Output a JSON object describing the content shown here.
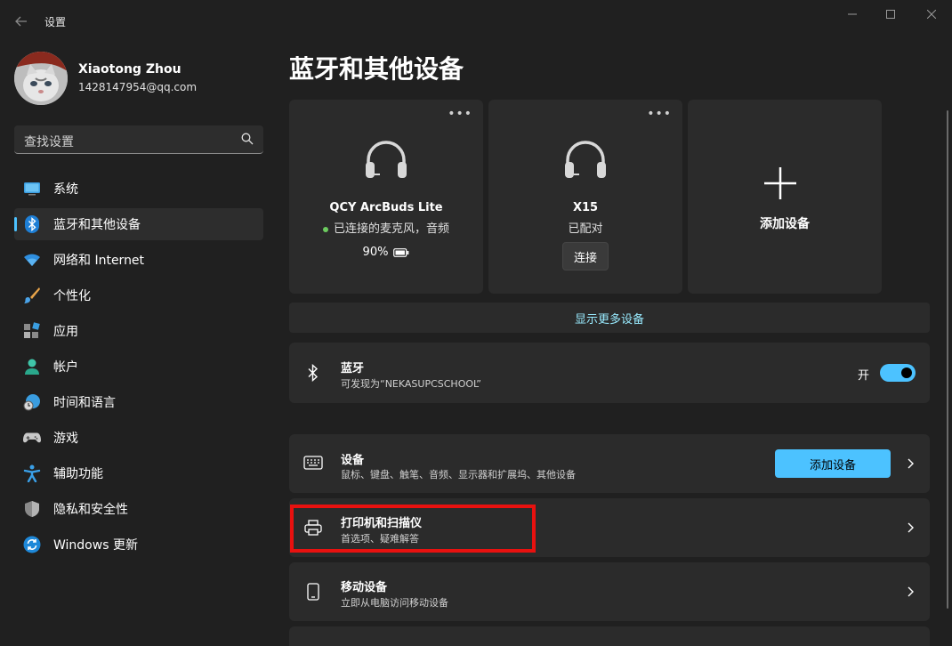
{
  "window": {
    "title": "设置"
  },
  "profile": {
    "name": "Xiaotong Zhou",
    "email": "1428147954@qq.com"
  },
  "search": {
    "placeholder": "查找设置"
  },
  "nav": {
    "items": [
      {
        "label": "系统",
        "icon": "monitor-icon",
        "active": false
      },
      {
        "label": "蓝牙和其他设备",
        "icon": "bluetooth-icon",
        "active": true
      },
      {
        "label": "网络和 Internet",
        "icon": "wifi-icon",
        "active": false
      },
      {
        "label": "个性化",
        "icon": "brush-icon",
        "active": false
      },
      {
        "label": "应用",
        "icon": "apps-icon",
        "active": false
      },
      {
        "label": "帐户",
        "icon": "person-icon",
        "active": false
      },
      {
        "label": "时间和语言",
        "icon": "globe-clock-icon",
        "active": false
      },
      {
        "label": "游戏",
        "icon": "gamepad-icon",
        "active": false
      },
      {
        "label": "辅助功能",
        "icon": "accessibility-icon",
        "active": false
      },
      {
        "label": "隐私和安全性",
        "icon": "shield-icon",
        "active": false
      },
      {
        "label": "Windows 更新",
        "icon": "update-icon",
        "active": false
      }
    ]
  },
  "page": {
    "title": "蓝牙和其他设备"
  },
  "device_cards": [
    {
      "name": "QCY ArcBuds Lite",
      "status": "已连接的麦克风，音频",
      "battery": "90%",
      "icon": "headphones-icon"
    },
    {
      "name": "X15",
      "status": "已配对",
      "action": "连接",
      "icon": "headphones-icon"
    }
  ],
  "add_card": {
    "label": "添加设备"
  },
  "show_more": {
    "label": "显示更多设备"
  },
  "bluetooth": {
    "title": "蓝牙",
    "subtitle": "可发现为“NEKASUPCSCHOOL”",
    "toggle_label": "开",
    "on": true
  },
  "rows": {
    "devices": {
      "title": "设备",
      "subtitle": "鼠标、键盘、触笔、音频、显示器和扩展坞、其他设备",
      "button": "添加设备"
    },
    "printers": {
      "title": "打印机和扫描仪",
      "subtitle": "首选项、疑难解答"
    },
    "mobile": {
      "title": "移动设备",
      "subtitle": "立即从电脑访问移动设备"
    }
  },
  "colors": {
    "accent": "#4cc2ff",
    "background": "#202020",
    "card": "#2b2b2b",
    "highlight": "#e8110f",
    "connected_dot": "#6ccb5f"
  }
}
